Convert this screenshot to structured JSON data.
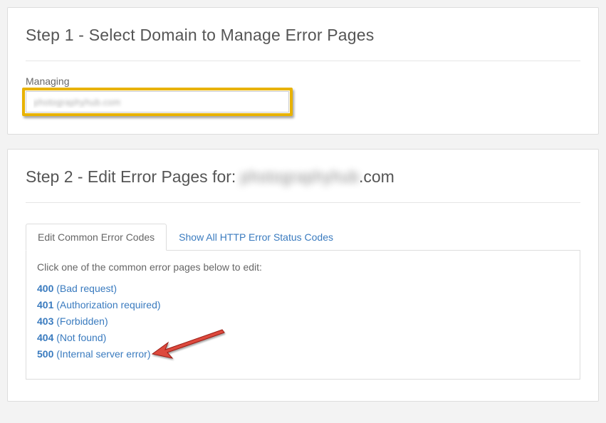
{
  "step1": {
    "heading": "Step 1 - Select Domain to Manage Error Pages",
    "managing_label": "Managing",
    "selected_domain": "photographyhub.com"
  },
  "step2": {
    "heading_prefix": "Step 2 - Edit Error Pages for: ",
    "heading_domain_blurred": "photographyhub",
    "heading_suffix": ".com",
    "tabs": [
      {
        "label": "Edit Common Error Codes",
        "active": true
      },
      {
        "label": "Show All HTTP Error Status Codes",
        "active": false
      }
    ],
    "instruction": "Click one of the common error pages below to edit:",
    "error_links": [
      {
        "code": "400",
        "desc": "(Bad request)"
      },
      {
        "code": "401",
        "desc": "(Authorization required)"
      },
      {
        "code": "403",
        "desc": "(Forbidden)"
      },
      {
        "code": "404",
        "desc": "(Not found)"
      },
      {
        "code": "500",
        "desc": "(Internal server error)"
      }
    ]
  },
  "annotation": {
    "highlight_color": "#e8b200",
    "arrow_color": "#d63333"
  }
}
